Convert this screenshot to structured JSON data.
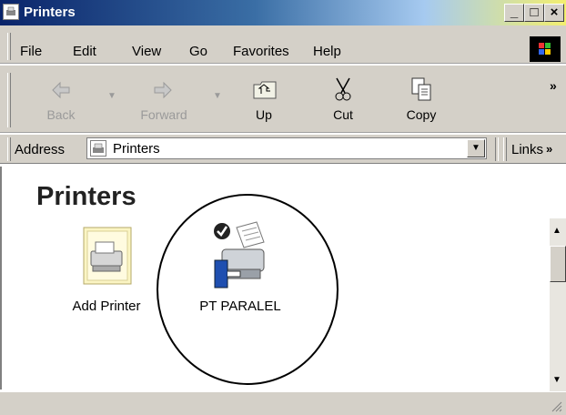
{
  "window": {
    "title": "Printers"
  },
  "menu": {
    "items": [
      "File",
      "Edit",
      "View",
      "Go",
      "Favorites",
      "Help"
    ]
  },
  "toolbar": {
    "buttons": [
      {
        "label": "Back",
        "icon": "back-arrow-icon",
        "enabled": false
      },
      {
        "label": "Forward",
        "icon": "forward-arrow-icon",
        "enabled": false
      },
      {
        "label": "Up",
        "icon": "up-folder-icon",
        "enabled": true
      },
      {
        "label": "Cut",
        "icon": "scissors-icon",
        "enabled": true
      },
      {
        "label": "Copy",
        "icon": "copy-icon",
        "enabled": true
      }
    ],
    "overflow": "»"
  },
  "address": {
    "label": "Address",
    "value": "Printers",
    "links_label": "Links",
    "links_overflow": "»"
  },
  "content": {
    "heading": "Printers",
    "items": [
      {
        "label": "Add Printer",
        "icon": "add-printer-icon"
      },
      {
        "label": "PT PARALEL",
        "icon": "default-printer-icon",
        "is_default": true
      }
    ]
  }
}
